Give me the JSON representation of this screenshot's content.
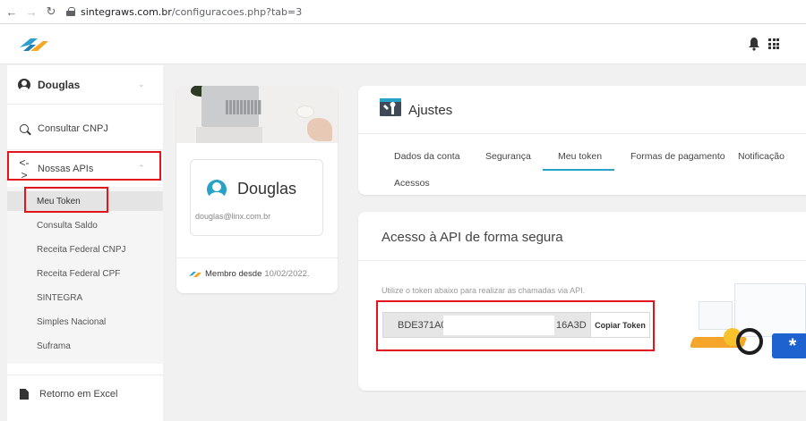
{
  "browser": {
    "url_host": "sintegraws.com.br",
    "url_path": "/configuracoes.php?tab=3"
  },
  "header": {
    "bell_icon": "bell-icon",
    "apps_icon": "apps-grid-icon"
  },
  "sidebar": {
    "user_name": "Douglas",
    "consultar": "Consultar CNPJ",
    "apis_label": "Nossas APIs",
    "apis_icon": "<->",
    "submenu": [
      "Meu Token",
      "Consulta Saldo",
      "Receita Federal CNPJ",
      "Receita Federal CPF",
      "SINTEGRA",
      "Simples Nacional",
      "Suframa"
    ],
    "excel": "Retorno em Excel"
  },
  "profile": {
    "name": "Douglas",
    "email": "douglas@linx.com.br",
    "member_label": "Membro desde",
    "member_date": "10/02/2022."
  },
  "settings": {
    "title": "Ajustes",
    "tabs": [
      "Dados da conta",
      "Segurança",
      "Meu token",
      "Formas de pagamento",
      "Notificação",
      "Acessos"
    ],
    "active_tab": "Meu token"
  },
  "api": {
    "title": "Acesso à API de forma segura",
    "help": "Utilize o token abaixo para realizar as chamadas via API.",
    "token_start": "BDE371A0",
    "token_end": "16A3D",
    "copy_label": "Copiar Token"
  },
  "colors": {
    "accent": "#28a2c6",
    "highlight": "#e3141b"
  }
}
